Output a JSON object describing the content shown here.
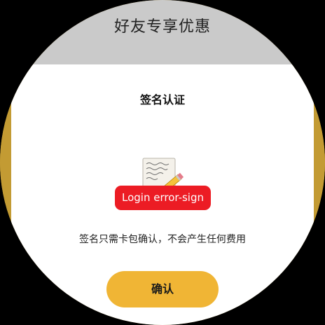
{
  "header": {
    "title": "好友专享优惠"
  },
  "sheet": {
    "title": "签名认证",
    "illustration_icon": "signature-document-pencil-icon",
    "error_toast": "Login error-sign",
    "description": "签名只需卡包确认，不会产生任何费用",
    "confirm_label": "确认"
  },
  "colors": {
    "background": "#000000",
    "header_band": "#cacaca",
    "side_accent": "#c39b33",
    "sheet": "#ffffff",
    "error_toast": "#ec1c24",
    "confirm_button": "#f0b535"
  }
}
